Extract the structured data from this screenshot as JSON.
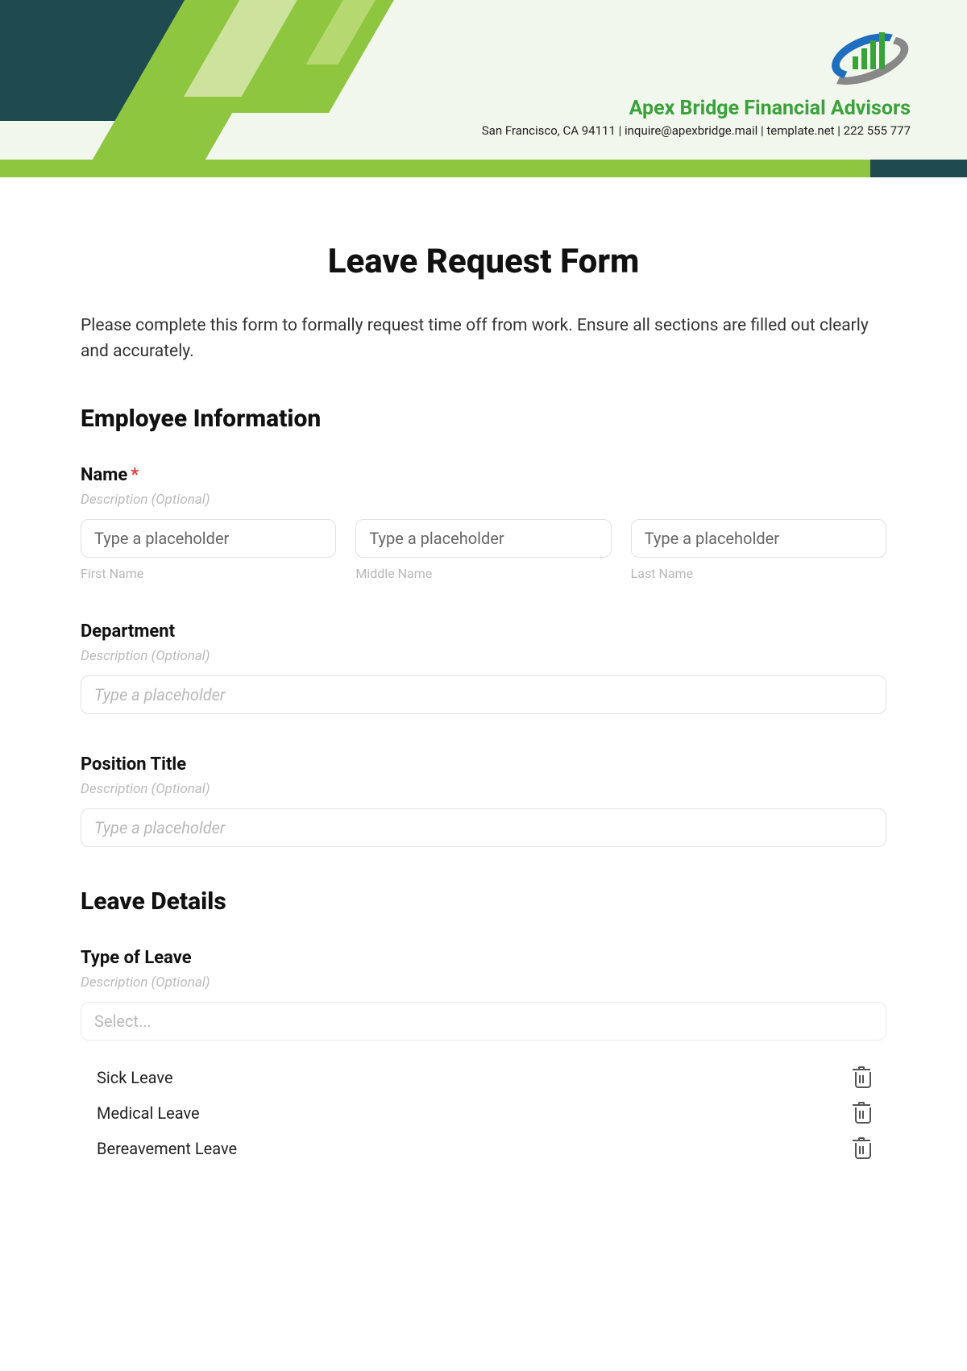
{
  "company": {
    "name": "Apex Bridge Financial Advisors",
    "info": "San Francisco, CA 94111 | inquire@apexbridge.mail | template.net | 222 555 777"
  },
  "title": "Leave Request Form",
  "intro": "Please complete this form to formally request time off from work. Ensure all sections are filled out clearly and accurately.",
  "sections": {
    "employee": "Employee Information",
    "leave": "Leave Details"
  },
  "fields": {
    "name": {
      "label": "Name",
      "required_marker": "*",
      "desc": "Description (Optional)",
      "placeholder": "Type a placeholder",
      "sublabels": {
        "first": "First Name",
        "middle": "Middle Name",
        "last": "Last Name"
      }
    },
    "department": {
      "label": "Department",
      "desc": "Description (Optional)",
      "placeholder": "Type a placeholder"
    },
    "position": {
      "label": "Position Title",
      "desc": "Description (Optional)",
      "placeholder": "Type a placeholder"
    },
    "leave_type": {
      "label": "Type of Leave",
      "desc": "Description (Optional)",
      "select_placeholder": "Select...",
      "options": [
        "Sick Leave",
        "Medical Leave",
        "Bereavement Leave"
      ]
    }
  }
}
